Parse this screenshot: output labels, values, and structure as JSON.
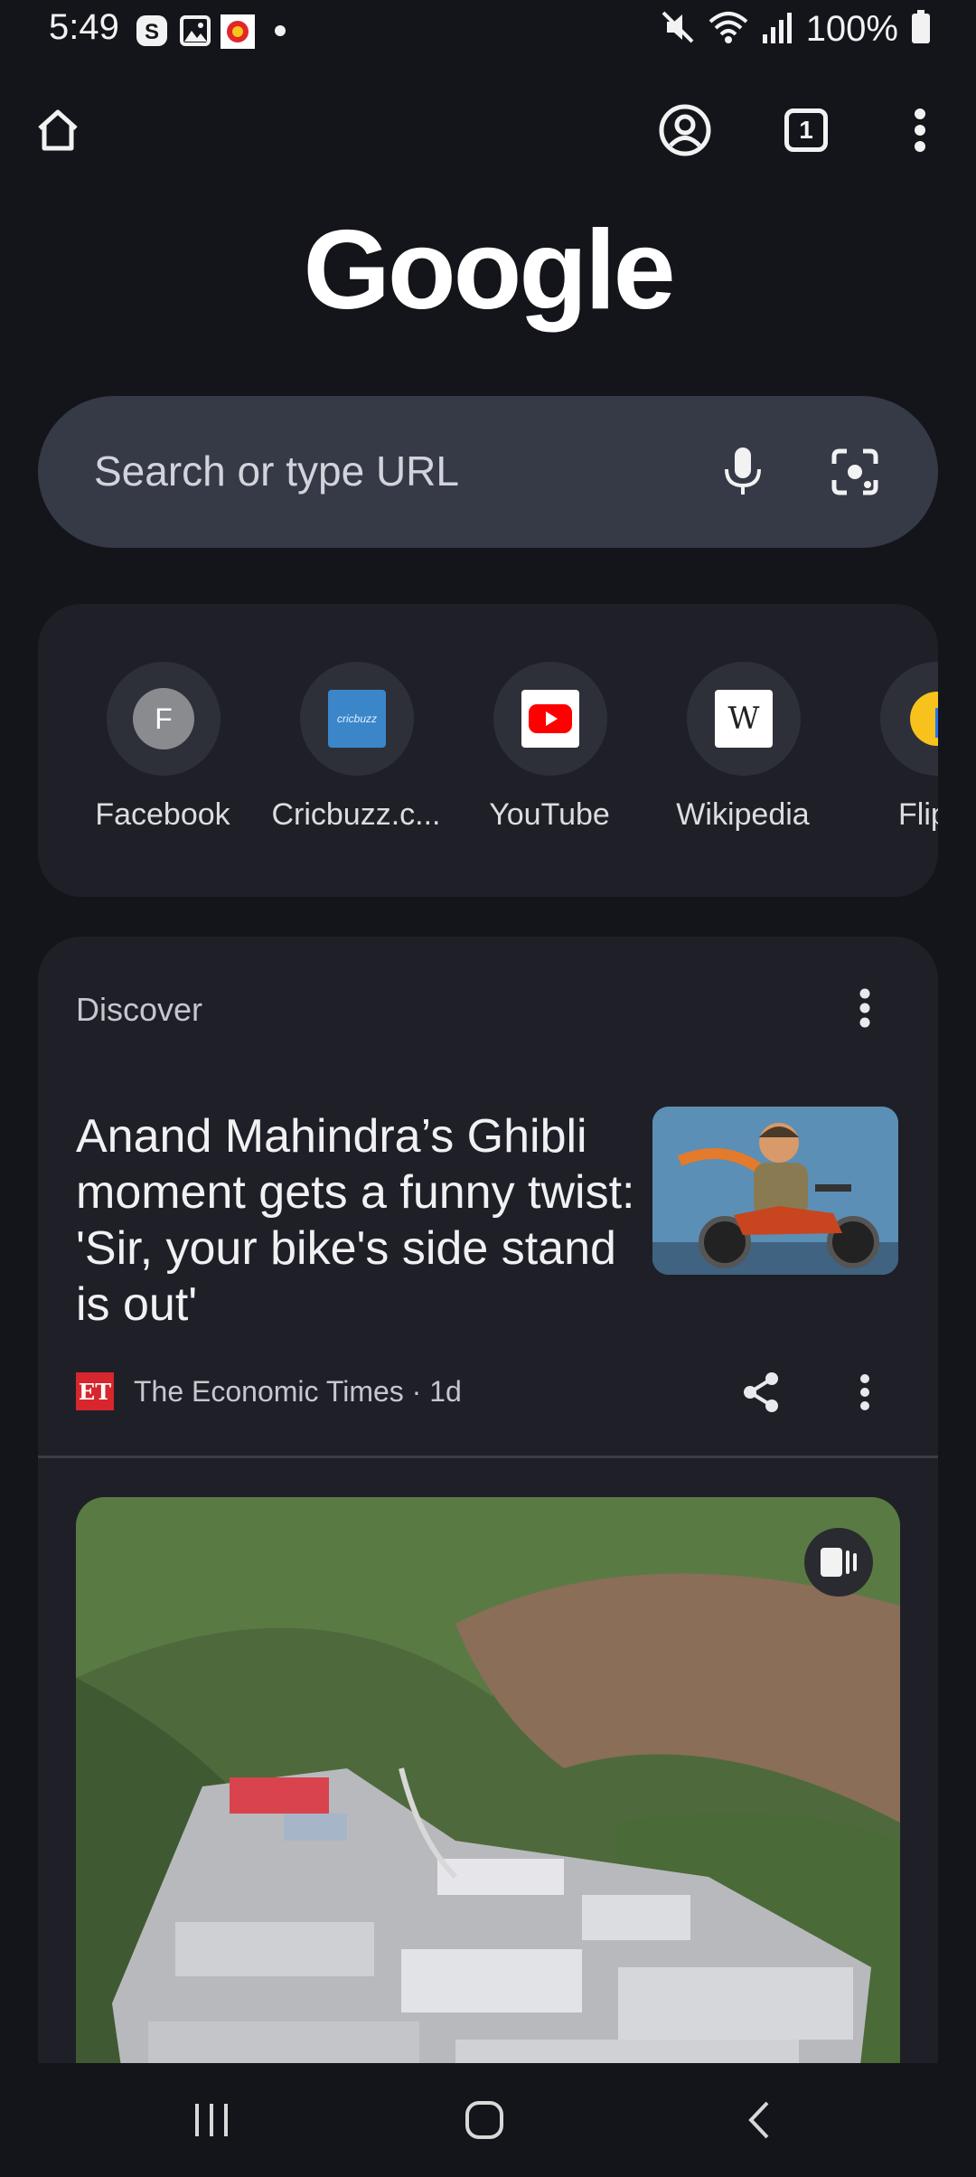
{
  "status_bar": {
    "time": "5:49",
    "battery": "100%"
  },
  "toolbar": {
    "tab_count": "1"
  },
  "logo": {
    "text": "Google"
  },
  "search": {
    "placeholder": "Search or type URL"
  },
  "shortcuts": [
    {
      "label": "Facebook",
      "letter": "F"
    },
    {
      "label": "Cricbuzz.c...",
      "icon_text": "cricbuzz"
    },
    {
      "label": "YouTube"
    },
    {
      "label": "Wikipedia",
      "icon_text": "W"
    },
    {
      "label": "Flipkar"
    }
  ],
  "discover": {
    "title": "Discover",
    "article": {
      "headline": "Anand Mahindra’s Ghibli moment gets a funny twist: 'Sir, your bike's side stand is out'",
      "source_logo": "ET",
      "source": "The Economic Times · 1d"
    }
  },
  "colors": {
    "background": "#14151a",
    "card": "#1f2027",
    "search_box": "#363a47",
    "et_red": "#d7262e",
    "youtube_red": "#ff0000"
  }
}
